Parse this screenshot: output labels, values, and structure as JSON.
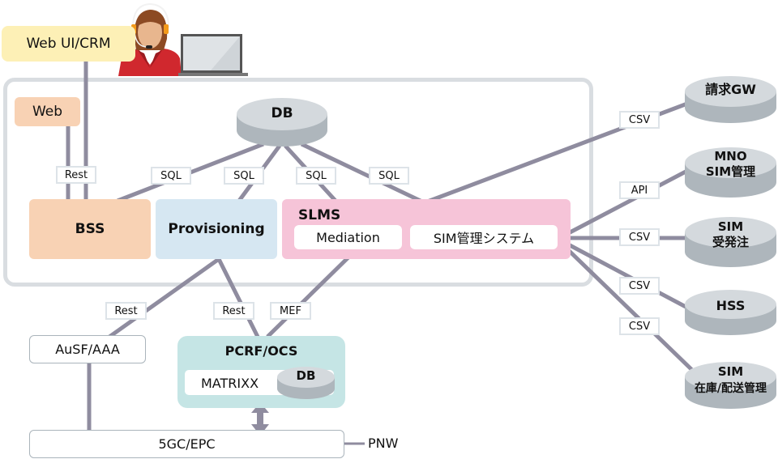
{
  "operator": {
    "crm_label": "Web UI/CRM"
  },
  "platform": {
    "web_label": "Web",
    "bss_label": "BSS",
    "provisioning_label": "Provisioning",
    "slms": {
      "title": "SLMS",
      "mediation_label": "Mediation",
      "sim_mgmt_label": "SIM管理システム"
    },
    "db_label": "DB"
  },
  "connection_labels": {
    "web_bss": "Rest",
    "db_bss": "SQL",
    "db_provisioning": "SQL",
    "db_mediation": "SQL",
    "db_sim_mgmt": "SQL",
    "billing_gw": "CSV",
    "mno_sim": "API",
    "sim_order": "CSV",
    "hss": "CSV",
    "sim_inventory": "CSV",
    "provisioning_ausf": "Rest",
    "provisioning_pcrf": "Rest",
    "mediation_pcrf": "MEF"
  },
  "external_systems": [
    {
      "line1": "請求GW",
      "line2": ""
    },
    {
      "line1": "MNO",
      "line2": "SIM管理"
    },
    {
      "line1": "SIM",
      "line2": "受発注"
    },
    {
      "line1": "HSS",
      "line2": ""
    },
    {
      "line1": "SIM",
      "line2": "在庫/配送管理"
    }
  ],
  "network": {
    "ausf_label": "AuSF/AAA",
    "pcrf_title": "PCRF/OCS",
    "matrixx_label": "MATRIXX",
    "pcrf_db_label": "DB",
    "core_label": "5GC/EPC",
    "pnw_label": "PNW"
  },
  "colors": {
    "wire": "#8f8c9f",
    "crm_bg": "#fdf0b6",
    "web_bss_bg": "#f8d2b4",
    "provisioning_bg": "#d6e7f2",
    "slms_bg": "#f6c4d8",
    "pcrf_bg": "#c5e5e5"
  }
}
